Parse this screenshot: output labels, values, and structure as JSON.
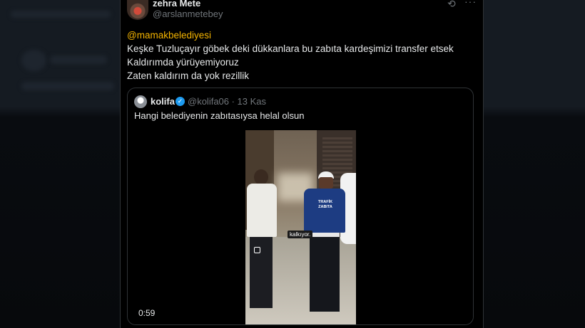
{
  "tweet": {
    "name": "zehra Mete",
    "handle": "@arslanmetebey",
    "lines": [
      "@mamakbelediyesi",
      "Keşke Tuzluçayır göbek deki dükkanlara bu zabıta kardeşimizi transfer etsek",
      "Kaldırımda yürüyemiyoruz",
      "Zaten kaldırım da  yok rezillik"
    ]
  },
  "quote": {
    "name": "kolifa",
    "handle_date": "@kolifa06 · 13 Kas",
    "text": "Hangi belediyenin zabıtasıysa helal olsun"
  },
  "video": {
    "caption": "kalkıyor.",
    "patch_text": "TRAFİK ZABITA",
    "duration": "0:59"
  },
  "icons": [
    "grok-icon",
    "more-icon",
    "verified-icon",
    "instagram-icon"
  ],
  "colors": {
    "background": "#000000",
    "mention": "#f4b400",
    "verified": "#1d9bf0",
    "text": "#e7e9ea",
    "muted": "#71767b"
  }
}
